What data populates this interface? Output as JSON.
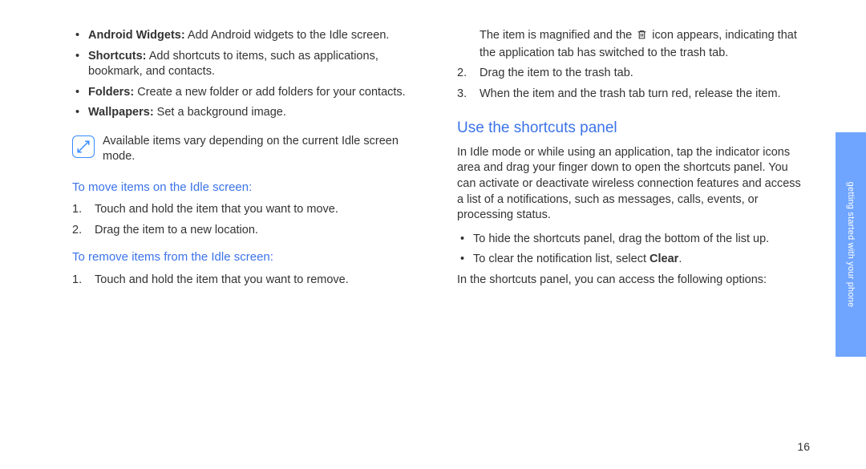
{
  "left": {
    "items": [
      {
        "label": "Android Widgets:",
        "text": " Add Android widgets to the Idle screen."
      },
      {
        "label": "Shortcuts:",
        "text": " Add shortcuts to items, such as applications, bookmark, and contacts."
      },
      {
        "label": "Folders:",
        "text": " Create a new folder or add folders for your contacts."
      },
      {
        "label": "Wallpapers:",
        "text": " Set a background image."
      }
    ],
    "note": "Available items vary depending on the current Idle screen mode.",
    "move_heading": "To move items on the Idle screen:",
    "move_steps": [
      "Touch and hold the item that you want to move.",
      "Drag the item to a new location."
    ],
    "remove_heading": "To remove items from the Idle screen:",
    "remove_steps": [
      "Touch and hold the item that you want to remove."
    ]
  },
  "right": {
    "continuation_pre": "The item is magnified and the ",
    "continuation_post": " icon appears, indicating that the application tab has switched to the trash tab.",
    "steps_cont": [
      "Drag the item to the trash tab.",
      "When the item and the trash tab turn red, release the item."
    ],
    "shortcuts_heading": "Use the shortcuts panel",
    "shortcuts_intro": "In Idle mode or while using an application, tap the indicator icons area and drag your finger down to open the shortcuts panel. You can activate or deactivate wireless connection features and access a list of a notifications, such as messages, calls, events, or processing status.",
    "shortcuts_bullets": [
      {
        "text": "To hide the shortcuts panel, drag the bottom of the list up."
      },
      {
        "pre": "To clear the notification list, select ",
        "bold": "Clear",
        "post": "."
      }
    ],
    "shortcuts_outro": "In the shortcuts panel, you can access the following options:"
  },
  "side_label": "getting started with your phone",
  "page_number": "16"
}
